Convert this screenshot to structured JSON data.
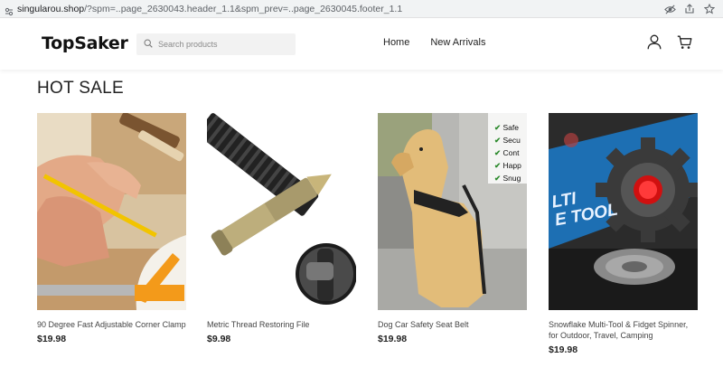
{
  "browser": {
    "url_host": "singularou.shop",
    "url_path": "/?spm=..page_2630043.header_1.1&spm_prev=..page_2630045.footer_1.1"
  },
  "header": {
    "logo": "TopSaker",
    "search_placeholder": "Search products",
    "nav": [
      "Home",
      "New Arrivals"
    ]
  },
  "section": {
    "title": "HOT SALE"
  },
  "products": [
    {
      "name": "90 Degree Fast Adjustable Corner Clamp",
      "price": "$19.98"
    },
    {
      "name": "Metric Thread Restoring File",
      "price": "$9.98"
    },
    {
      "name": "Dog Car Safety Seat Belt",
      "price": "$19.98"
    },
    {
      "name": "Snowflake Multi-Tool & Fidget Spinner, for Outdoor, Travel, Camping",
      "price": "$19.98"
    }
  ],
  "product_images": {
    "seatbelt_checklist": [
      "Safe",
      "Secu",
      "Cont",
      "Happ",
      "Snug"
    ],
    "multitool_text": "LTI\nE TOOL"
  }
}
